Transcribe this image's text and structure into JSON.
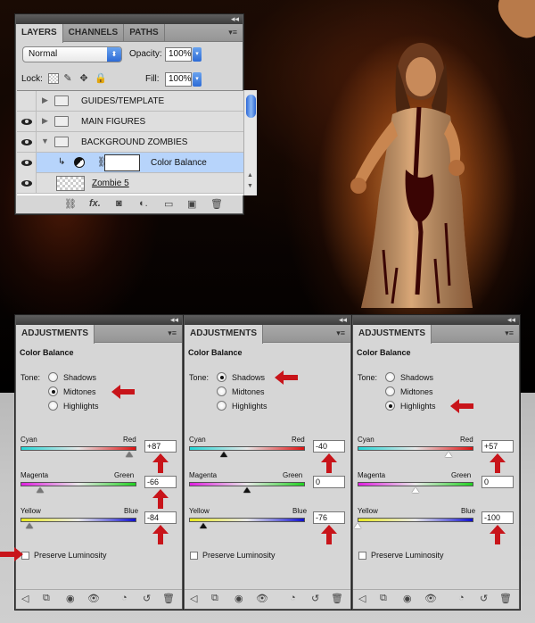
{
  "layers_panel": {
    "tabs": [
      "LAYERS",
      "CHANNELS",
      "PATHS"
    ],
    "blend_mode": "Normal",
    "opacity_label": "Opacity:",
    "opacity_value": "100%",
    "lock_label": "Lock:",
    "fill_label": "Fill:",
    "fill_value": "100%",
    "layers": [
      {
        "name": "GUIDES/TEMPLATE",
        "visible": false,
        "type": "group",
        "expanded": false
      },
      {
        "name": "MAIN FIGURES",
        "visible": true,
        "type": "group",
        "expanded": false
      },
      {
        "name": "BACKGROUND ZOMBIES",
        "visible": true,
        "type": "group",
        "expanded": true
      },
      {
        "name": "Color Balance",
        "visible": true,
        "type": "adjustment",
        "selected": true
      },
      {
        "name": "Zombie 5",
        "visible": true,
        "type": "pixel"
      }
    ]
  },
  "adjustments": [
    {
      "tab": "ADJUSTMENTS",
      "title": "Color Balance",
      "tone_label": "Tone:",
      "tones": [
        "Shadows",
        "Midtones",
        "Highlights"
      ],
      "selected_tone": "Midtones",
      "sliders": [
        {
          "left": "Cyan",
          "right": "Red",
          "value": "+87",
          "pos": 87
        },
        {
          "left": "Magenta",
          "right": "Green",
          "value": "-66",
          "pos": -66
        },
        {
          "left": "Yellow",
          "right": "Blue",
          "value": "-84",
          "pos": -84
        }
      ],
      "preserve_label": "Preserve Luminosity",
      "preserve_checked": false
    },
    {
      "tab": "ADJUSTMENTS",
      "title": "Color Balance",
      "tone_label": "Tone:",
      "tones": [
        "Shadows",
        "Midtones",
        "Highlights"
      ],
      "selected_tone": "Shadows",
      "sliders": [
        {
          "left": "Cyan",
          "right": "Red",
          "value": "-40",
          "pos": -40
        },
        {
          "left": "Magenta",
          "right": "Green",
          "value": "0",
          "pos": 0
        },
        {
          "left": "Yellow",
          "right": "Blue",
          "value": "-76",
          "pos": -76
        }
      ],
      "preserve_label": "Preserve Luminosity",
      "preserve_checked": false
    },
    {
      "tab": "ADJUSTMENTS",
      "title": "Color Balance",
      "tone_label": "Tone:",
      "tones": [
        "Shadows",
        "Midtones",
        "Highlights"
      ],
      "selected_tone": "Highlights",
      "sliders": [
        {
          "left": "Cyan",
          "right": "Red",
          "value": "+57",
          "pos": 57
        },
        {
          "left": "Magenta",
          "right": "Green",
          "value": "0",
          "pos": 0
        },
        {
          "left": "Yellow",
          "right": "Blue",
          "value": "-100",
          "pos": -100
        }
      ],
      "preserve_label": "Preserve Luminosity",
      "preserve_checked": false
    }
  ],
  "colors": {
    "arrow_red": "#c8141a",
    "selection_blue": "#b7d4fb",
    "panel_gray": "#d6d6d6"
  }
}
